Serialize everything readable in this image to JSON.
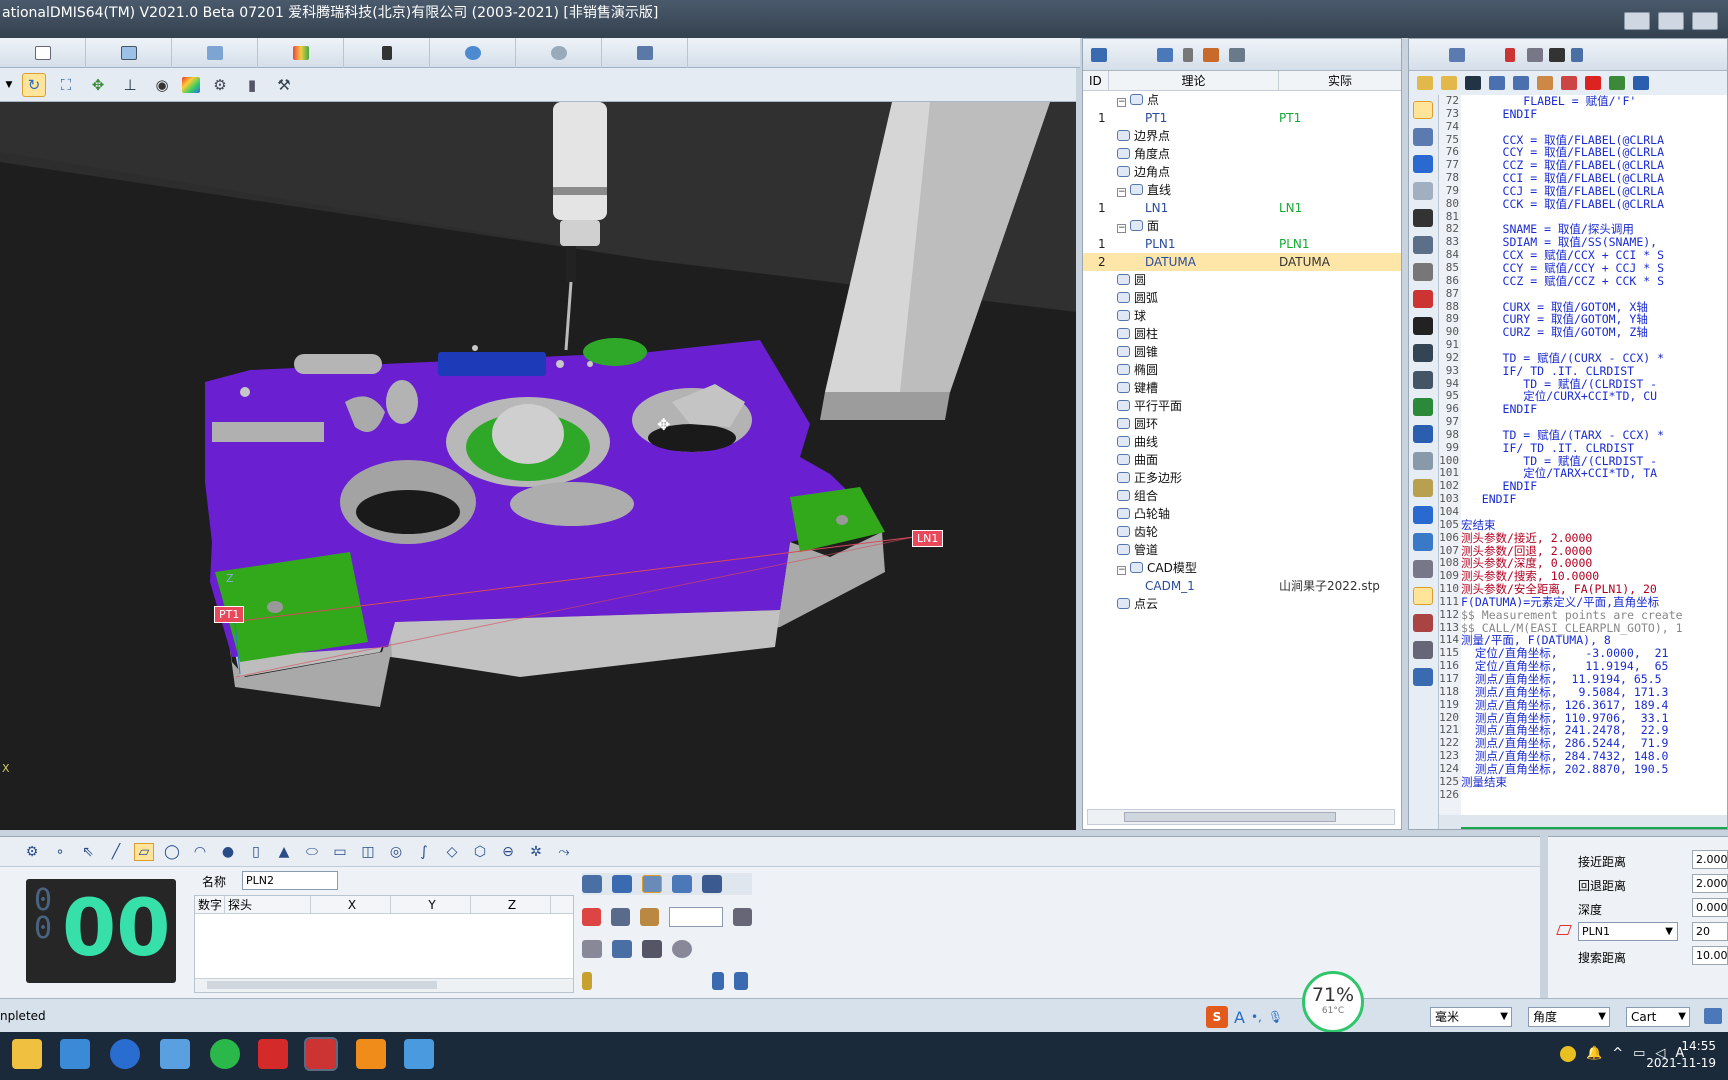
{
  "window": {
    "title": "ationalDMIS64(TM) V2021.0 Beta 07201   爱科腾瑞科技(北京)有限公司 (2003-2021) [非销售演示版]"
  },
  "viewport": {
    "labels": {
      "pt1": "PT1",
      "ln1": "LN1",
      "axis_z": "Z",
      "axis_x": "X"
    }
  },
  "tree": {
    "columns": [
      "ID",
      "理论",
      "实际"
    ],
    "rows": [
      {
        "id": "",
        "name": "点",
        "actual": "",
        "indent": 1,
        "group": true
      },
      {
        "id": "1",
        "name": "PT1",
        "actual": "PT1",
        "indent": 2
      },
      {
        "id": "",
        "name": "边界点",
        "actual": "",
        "indent": 1
      },
      {
        "id": "",
        "name": "角度点",
        "actual": "",
        "indent": 1
      },
      {
        "id": "",
        "name": "边角点",
        "actual": "",
        "indent": 1
      },
      {
        "id": "",
        "name": "直线",
        "actual": "",
        "indent": 1,
        "group": true
      },
      {
        "id": "1",
        "name": "LN1",
        "actual": "LN1",
        "indent": 2
      },
      {
        "id": "",
        "name": "面",
        "actual": "",
        "indent": 1,
        "group": true
      },
      {
        "id": "1",
        "name": "PLN1",
        "actual": "PLN1",
        "indent": 2
      },
      {
        "id": "2",
        "name": "DATUMA",
        "actual": "DATUMA",
        "indent": 2,
        "selected": true
      },
      {
        "id": "",
        "name": "圆",
        "actual": "",
        "indent": 1
      },
      {
        "id": "",
        "name": "圆弧",
        "actual": "",
        "indent": 1
      },
      {
        "id": "",
        "name": "球",
        "actual": "",
        "indent": 1
      },
      {
        "id": "",
        "name": "圆柱",
        "actual": "",
        "indent": 1
      },
      {
        "id": "",
        "name": "圆锥",
        "actual": "",
        "indent": 1
      },
      {
        "id": "",
        "name": "椭圆",
        "actual": "",
        "indent": 1
      },
      {
        "id": "",
        "name": "键槽",
        "actual": "",
        "indent": 1
      },
      {
        "id": "",
        "name": "平行平面",
        "actual": "",
        "indent": 1
      },
      {
        "id": "",
        "name": "圆环",
        "actual": "",
        "indent": 1
      },
      {
        "id": "",
        "name": "曲线",
        "actual": "",
        "indent": 1
      },
      {
        "id": "",
        "name": "曲面",
        "actual": "",
        "indent": 1
      },
      {
        "id": "",
        "name": "正多边形",
        "actual": "",
        "indent": 1
      },
      {
        "id": "",
        "name": "组合",
        "actual": "",
        "indent": 1
      },
      {
        "id": "",
        "name": "凸轮轴",
        "actual": "",
        "indent": 1
      },
      {
        "id": "",
        "name": "齿轮",
        "actual": "",
        "indent": 1
      },
      {
        "id": "",
        "name": "管道",
        "actual": "",
        "indent": 1
      },
      {
        "id": "",
        "name": "CAD模型",
        "actual": "",
        "indent": 1,
        "group": true
      },
      {
        "id": "",
        "name": "CADM_1",
        "actual": "山涧果子2022.stp",
        "indent": 2
      },
      {
        "id": "",
        "name": "点云",
        "actual": "",
        "indent": 1
      }
    ]
  },
  "code": {
    "lines": [
      {
        "n": "72",
        "t": "         FLABEL = 赋值/'F'"
      },
      {
        "n": "73",
        "t": "      ENDIF"
      },
      {
        "n": "74",
        "t": ""
      },
      {
        "n": "75",
        "t": "      CCX = 取值/FLABEL(@CLRLA"
      },
      {
        "n": "76",
        "t": "      CCY = 取值/FLABEL(@CLRLA"
      },
      {
        "n": "77",
        "t": "      CCZ = 取值/FLABEL(@CLRLA"
      },
      {
        "n": "78",
        "t": "      CCI = 取值/FLABEL(@CLRLA"
      },
      {
        "n": "79",
        "t": "      CCJ = 取值/FLABEL(@CLRLA"
      },
      {
        "n": "80",
        "t": "      CCK = 取值/FLABEL(@CLRLA"
      },
      {
        "n": "81",
        "t": ""
      },
      {
        "n": "82",
        "t": "      SNAME = 取值/探头调用"
      },
      {
        "n": "83",
        "t": "      SDIAM = 取值/SS(SNAME),"
      },
      {
        "n": "84",
        "t": "      CCX = 赋值/CCX + CCI * S"
      },
      {
        "n": "85",
        "t": "      CCY = 赋值/CCY + CCJ * S"
      },
      {
        "n": "86",
        "t": "      CCZ = 赋值/CCZ + CCK * S"
      },
      {
        "n": "87",
        "t": ""
      },
      {
        "n": "88",
        "t": "      CURX = 取值/GOTOM, X轴"
      },
      {
        "n": "89",
        "t": "      CURY = 取值/GOTOM, Y轴"
      },
      {
        "n": "90",
        "t": "      CURZ = 取值/GOTOM, Z轴"
      },
      {
        "n": "91",
        "t": ""
      },
      {
        "n": "92",
        "t": "      TD = 赋值/(CURX - CCX) *"
      },
      {
        "n": "93",
        "t": "      IF/ TD .IT. CLRDIST"
      },
      {
        "n": "94",
        "t": "         TD = 赋值/(CLRDIST -"
      },
      {
        "n": "95",
        "t": "         定位/CURX+CCI*TD, CU"
      },
      {
        "n": "96",
        "t": "      ENDIF"
      },
      {
        "n": "97",
        "t": ""
      },
      {
        "n": "98",
        "t": "      TD = 赋值/(TARX - CCX) *"
      },
      {
        "n": "99",
        "t": "      IF/ TD .IT. CLRDIST"
      },
      {
        "n": "100",
        "t": "         TD = 赋值/(CLRDIST -"
      },
      {
        "n": "101",
        "t": "         定位/TARX+CCI*TD, TA"
      },
      {
        "n": "102",
        "t": "      ENDIF"
      },
      {
        "n": "103",
        "t": "   ENDIF"
      },
      {
        "n": "104",
        "t": ""
      },
      {
        "n": "105",
        "t": "宏结束",
        "cls": "c-kw"
      },
      {
        "n": "106",
        "t": "测头参数/接近, 2.0000",
        "cls": "c-rd"
      },
      {
        "n": "107",
        "t": "测头参数/回退, 2.0000",
        "cls": "c-rd"
      },
      {
        "n": "108",
        "t": "测头参数/深度, 0.0000",
        "cls": "c-rd"
      },
      {
        "n": "109",
        "t": "测头参数/搜索, 10.0000",
        "cls": "c-rd"
      },
      {
        "n": "110",
        "t": "测头参数/安全距离, FA(PLN1), 20",
        "cls": "c-rd"
      },
      {
        "n": "111",
        "t": "F(DATUMA)=元素定义/平面,直角坐标",
        "cls": "c-kw"
      },
      {
        "n": "112",
        "t": "$$ Measurement points are create",
        "cls": "c-cm"
      },
      {
        "n": "113",
        "t": "$$ CALL/M(EASI_CLEARPLN_GOTO), 1",
        "cls": "c-cm"
      },
      {
        "n": "114",
        "t": "测量/平面, F(DATUMA), 8",
        "cls": "c-kw"
      },
      {
        "n": "115",
        "t": "  定位/直角坐标,    -3.0000,  21",
        "cls": "c-kw"
      },
      {
        "n": "116",
        "t": "  定位/直角坐标,    11.9194,  65",
        "cls": "c-kw"
      },
      {
        "n": "117",
        "t": "  测点/直角坐标,  11.9194, 65.5",
        "cls": "c-kw"
      },
      {
        "n": "118",
        "t": "  测点/直角坐标,   9.5084, 171.3",
        "cls": "c-kw"
      },
      {
        "n": "119",
        "t": "  测点/直角坐标, 126.3617, 189.4",
        "cls": "c-kw"
      },
      {
        "n": "120",
        "t": "  测点/直角坐标, 110.9706,  33.1",
        "cls": "c-kw"
      },
      {
        "n": "121",
        "t": "  测点/直角坐标, 241.2478,  22.9",
        "cls": "c-kw"
      },
      {
        "n": "122",
        "t": "  测点/直角坐标, 286.5244,  71.9",
        "cls": "c-kw"
      },
      {
        "n": "123",
        "t": "  测点/直角坐标, 284.7432, 148.0",
        "cls": "c-kw"
      },
      {
        "n": "124",
        "t": "  测点/直角坐标, 202.8870, 190.5",
        "cls": "c-kw"
      },
      {
        "n": "125",
        "t": "测量结束",
        "cls": "c-kw"
      },
      {
        "n": "126",
        "t": ""
      }
    ]
  },
  "bottom": {
    "counter_small": "0\n0",
    "counter_big": "00",
    "name_label": "名称",
    "name_value": "PLN2",
    "table_columns": [
      "数字",
      "探头",
      "X",
      "Y",
      "Z"
    ]
  },
  "props": {
    "approach_label": "接近距离",
    "approach_value": "2.000",
    "retract_label": "回退距离",
    "retract_value": "2.000",
    "depth_label": "深度",
    "depth_value": "0.000",
    "plane_value": "PLN1",
    "plane_dist": "20",
    "search_label": "搜索距离",
    "search_value": "10.00"
  },
  "status": {
    "text": "npleted",
    "unit": "毫米",
    "angle": "角度",
    "coord": "Cart",
    "badge_pct": "71%",
    "badge_temp": "61°C",
    "ime": "A"
  },
  "taskbar": {
    "time": "14:55",
    "date": "2021-11-19"
  }
}
